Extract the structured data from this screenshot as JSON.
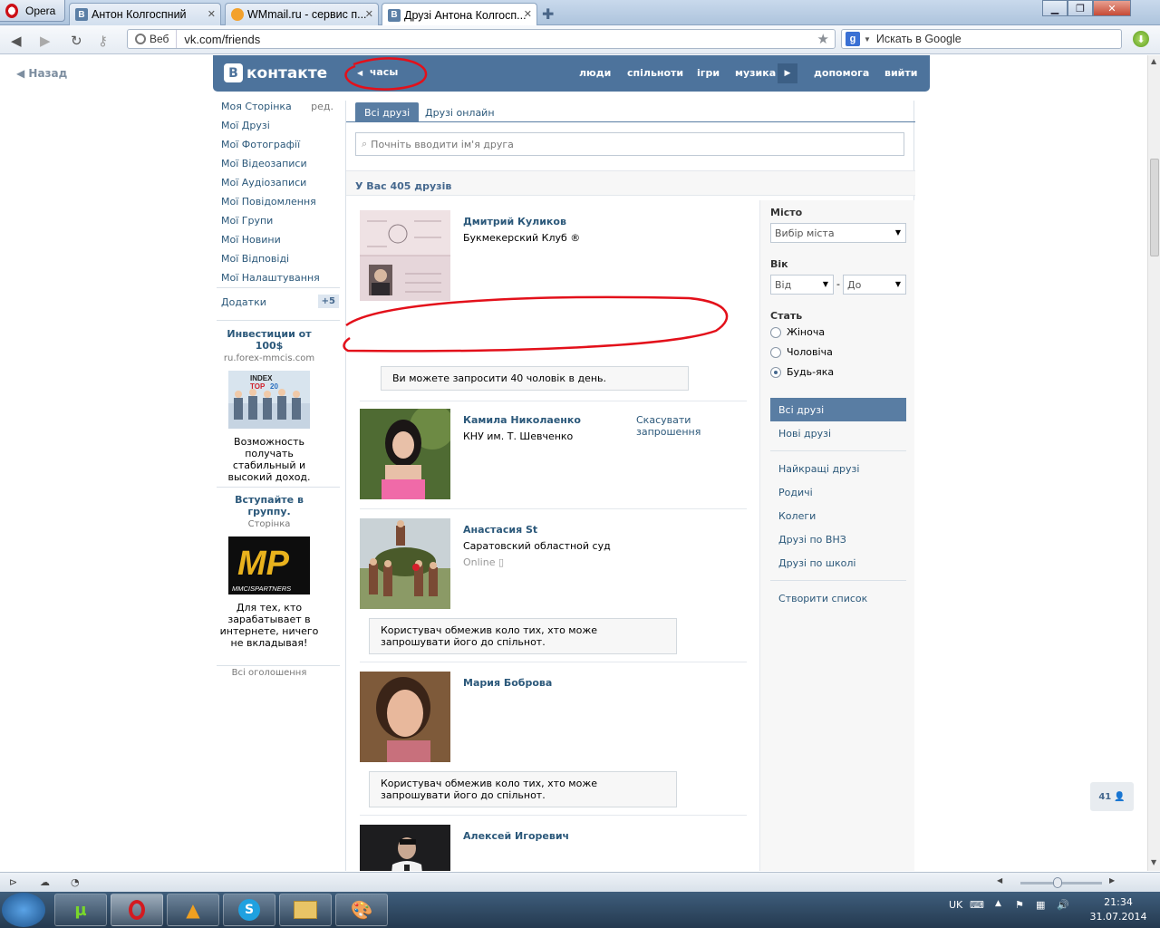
{
  "browser": {
    "menu_label": "Opera",
    "tabs": [
      {
        "title": "Антон Колгоспний"
      },
      {
        "title": "WMmail.ru - сервис п..."
      },
      {
        "title": "Друзі Антона Колгосп..."
      }
    ],
    "web_label": "Веб",
    "url": "vk.com/friends",
    "search_placeholder": "Искать в Google",
    "back_link": "Назад"
  },
  "vk_header": {
    "logo_text": "контакте",
    "logo_letter": "В",
    "clock_label": "часы",
    "nav": [
      "люди",
      "спільноти",
      "ігри",
      "музика",
      "допомога",
      "вийти"
    ]
  },
  "left_menu": {
    "items": [
      "Моя Сторінка",
      "Мої Друзі",
      "Мої Фотографії",
      "Мої Відеозаписи",
      "Мої Аудіозаписи",
      "Мої Повідомлення",
      "Мої Групи",
      "Мої Новини",
      "Мої Відповіді",
      "Мої Налаштування"
    ],
    "edit_label": "ред.",
    "apps_label": "Додатки",
    "apps_badge": "+5"
  },
  "ads": [
    {
      "title": "Инвестиции от 100$",
      "site": "ru.forex-mmcis.com",
      "img_text_1": "INDEX",
      "img_text_2": "TOP",
      "img_text_3": "20",
      "text": "Возможность получать стабильный и высокий доход."
    },
    {
      "title": "Вступайте в группу.",
      "site": "Сторінка",
      "img_text_1": "MP",
      "img_text_2": "MMCISPARTNERS",
      "text": "Для тех, кто зарабатывает в интернете, ничего не вкладывая!"
    }
  ],
  "all_ads_link": "Всі оголошення",
  "friends_tabs": [
    "Всі друзі",
    "Друзі онлайн"
  ],
  "friend_search_placeholder": "Почніть вводити ім'я друга",
  "friends_count": "У Вас 405 друзів",
  "friends": [
    {
      "name": "Дмитрий Куликов",
      "info": "Букмекерский Клуб ®",
      "notice": "Ви можете запросити 40 чоловік в день."
    },
    {
      "name": "Камила Николаенко",
      "info": "КНУ им. Т. Шевченко",
      "action": "Скасувати запрошення"
    },
    {
      "name": "Анастасия St",
      "info": "Саратовский областной суд",
      "online": "Online",
      "notice": "Користувач обмежив коло тих, хто може запрошувати його до спільнот."
    },
    {
      "name": "Мария Боброва",
      "notice": "Користувач обмежив коло тих, хто може запрошувати його до спільнот."
    },
    {
      "name": "Алексей Игоревич"
    }
  ],
  "filters": {
    "city_label": "Місто",
    "city_select": "Вибір міста",
    "age_label": "Вік",
    "age_from": "Від",
    "age_dash": "-",
    "age_to": "До",
    "gender_label": "Стать",
    "gender_options": [
      "Жіноча",
      "Чоловіча",
      "Будь-яка"
    ],
    "gender_selected": "Будь-яка",
    "menu": [
      "Всі друзі",
      "Нові друзі",
      "Найкращі друзі",
      "Родичі",
      "Колеги",
      "Друзі по ВНЗ",
      "Друзі по школі",
      "Створити список"
    ]
  },
  "online_bubble": "41",
  "taskbar": {
    "lang": "UK",
    "time": "21:34",
    "date": "31.07.2014"
  },
  "colors": {
    "vk_blue": "#4d739c",
    "link": "#2b587a",
    "annotation_red": "#e3101a"
  }
}
